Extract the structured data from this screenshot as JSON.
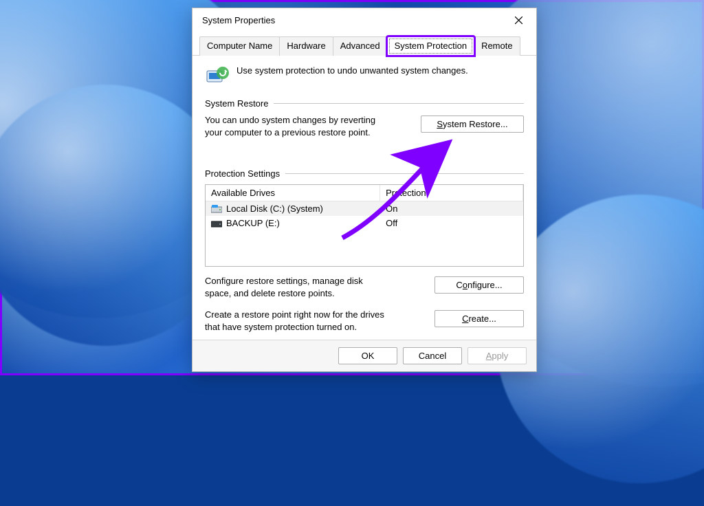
{
  "window": {
    "title": "System Properties"
  },
  "tabs": [
    "Computer Name",
    "Hardware",
    "Advanced",
    "System Protection",
    "Remote"
  ],
  "intro": "Use system protection to undo unwanted system changes.",
  "sections": {
    "restore": {
      "label": "System Restore",
      "desc": "You can undo system changes by reverting your computer to a previous restore point.",
      "button_plain": "System Restore...",
      "button_access": "S"
    },
    "settings": {
      "label": "Protection Settings",
      "columns": [
        "Available Drives",
        "Protection"
      ],
      "rows": [
        {
          "name": "Local Disk (C:) (System)",
          "protection": "On",
          "icon": "system-drive"
        },
        {
          "name": "BACKUP (E:)",
          "protection": "Off",
          "icon": "drive"
        }
      ],
      "configure_desc": "Configure restore settings, manage disk space, and delete restore points.",
      "configure_button": "Configure...",
      "create_desc": "Create a restore point right now for the drives that have system protection turned on.",
      "create_button": "Create..."
    }
  },
  "footer": {
    "ok": "OK",
    "cancel": "Cancel",
    "apply": "Apply"
  },
  "highlight": {
    "annotation_color": "#8000ff"
  }
}
